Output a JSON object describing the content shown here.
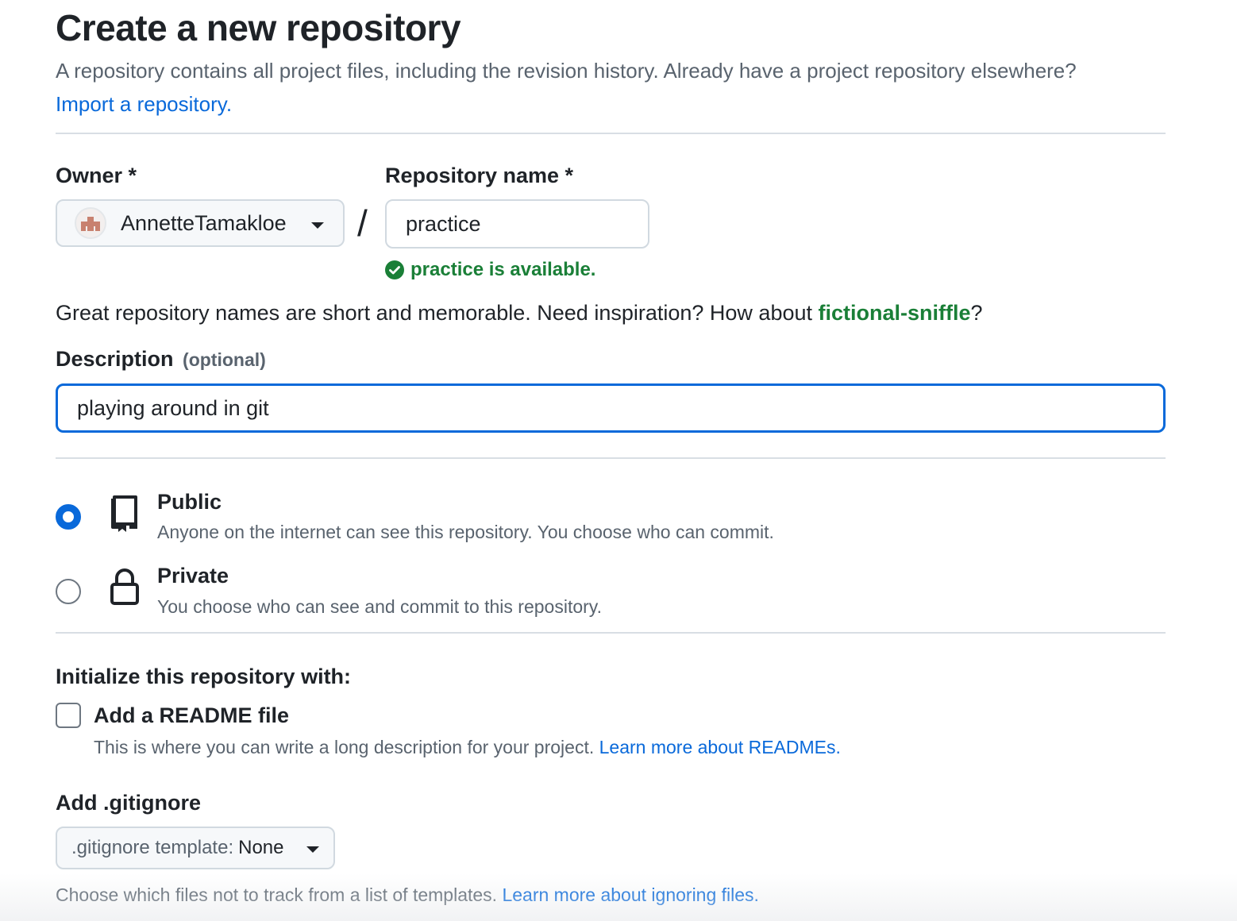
{
  "header": {
    "title": "Create a new repository",
    "subtitle": "A repository contains all project files, including the revision history. Already have a project repository elsewhere?",
    "import_link": "Import a repository."
  },
  "owner": {
    "label": "Owner *",
    "value": "AnnetteTamakloe",
    "avatar_icon": "user-avatar"
  },
  "separator": "/",
  "repo_name": {
    "label": "Repository name *",
    "value": "practice",
    "status": "practice is available.",
    "status_icon": "check-circle-icon",
    "status_color": "#1a7f37"
  },
  "hint": {
    "prefix": "Great repository names are short and memorable. Need inspiration? How about ",
    "suggestion": "fictional-sniffle",
    "suffix": "?"
  },
  "description": {
    "label": "Description",
    "optional": "(optional)",
    "value": "playing around in git"
  },
  "visibility": {
    "selected": "public",
    "options": [
      {
        "id": "public",
        "title": "Public",
        "desc": "Anyone on the internet can see this repository. You choose who can commit.",
        "icon": "repo-icon",
        "checked": true
      },
      {
        "id": "private",
        "title": "Private",
        "desc": "You choose who can see and commit to this repository.",
        "icon": "lock-icon",
        "checked": false
      }
    ]
  },
  "initialize": {
    "heading": "Initialize this repository with:",
    "readme": {
      "label": "Add a README file",
      "desc": "This is where you can write a long description for your project. ",
      "link": "Learn more about READMEs.",
      "checked": false
    }
  },
  "gitignore": {
    "label": "Add .gitignore",
    "select_prefix": ".gitignore template:",
    "select_value": "None",
    "desc": "Choose which files not to track from a list of templates. ",
    "link": "Learn more about ignoring files."
  },
  "colors": {
    "accent": "#0969da",
    "success": "#1a7f37",
    "muted": "#59636e"
  }
}
